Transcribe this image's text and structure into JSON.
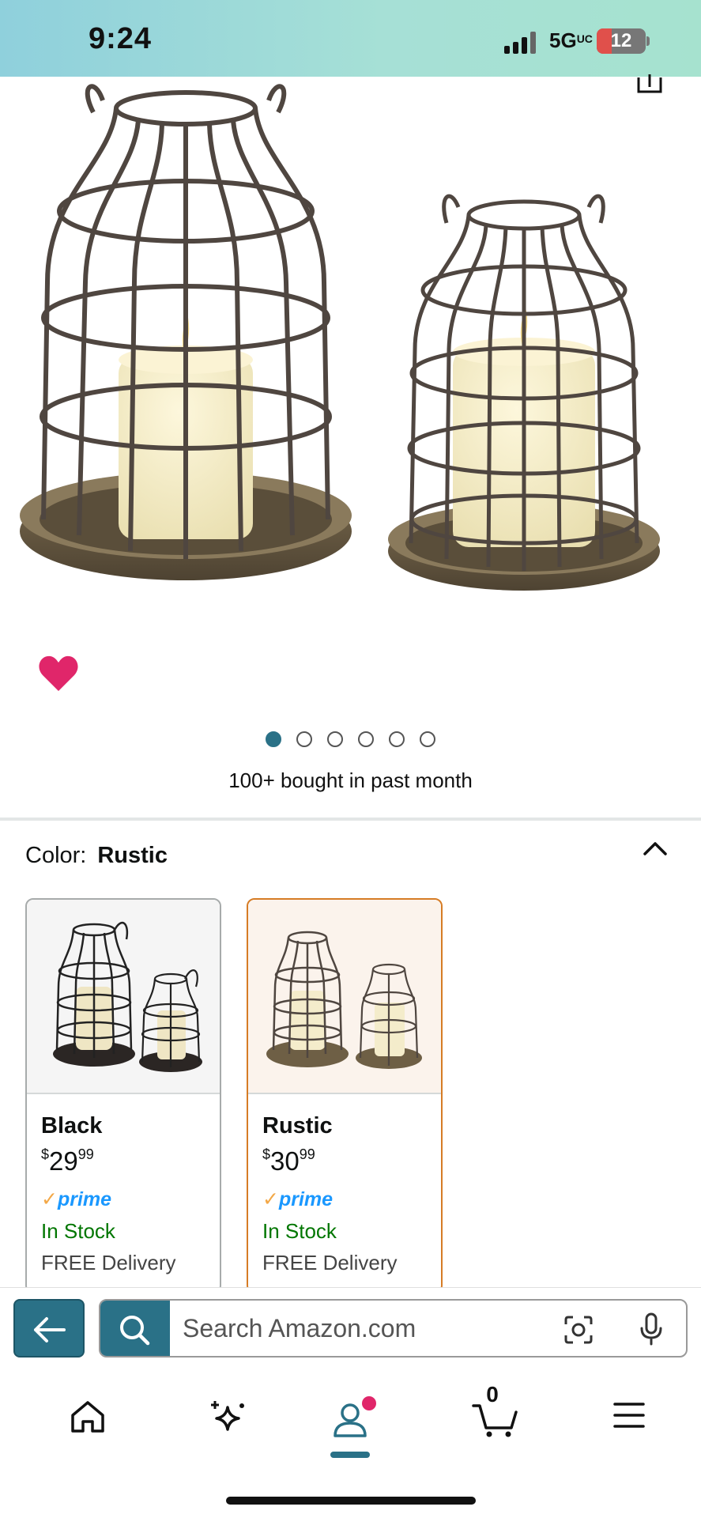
{
  "status_bar": {
    "time": "9:24",
    "network": "5G",
    "battery": "12"
  },
  "product": {
    "image_count": 6,
    "active_image": 1,
    "bought_text": "100+ bought in past month"
  },
  "color_section": {
    "label": "Color:",
    "selected": "Rustic",
    "swatches": [
      {
        "name": "Black",
        "currency": "$",
        "price_whole": "29",
        "price_fraction": "99",
        "prime": "prime",
        "stock": "In Stock",
        "delivery": "FREE Delivery"
      },
      {
        "name": "Rustic",
        "currency": "$",
        "price_whole": "30",
        "price_fraction": "99",
        "prime": "prime",
        "stock": "In Stock",
        "delivery": "FREE Delivery"
      }
    ]
  },
  "search": {
    "placeholder": "Search Amazon.com"
  },
  "nav": {
    "cart_count": "0"
  },
  "colors": {
    "accent": "#2a7187",
    "prime": "#1a98ff",
    "stock": "#007600",
    "selected_border": "#d67c25",
    "heart": "#e0266a"
  }
}
